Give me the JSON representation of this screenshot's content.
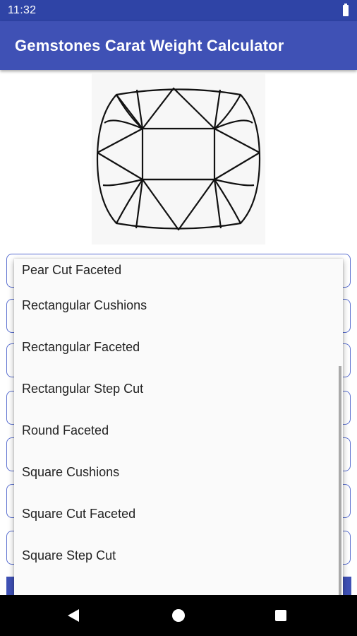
{
  "status_bar": {
    "time": "11:32",
    "battery_icon": "battery-icon"
  },
  "app_bar": {
    "title": "Gemstones Carat Weight Calculator",
    "color": "#3f51b5"
  },
  "gem_image": {
    "icon": "cushion-cut-gem-icon"
  },
  "dropdown": {
    "options": [
      "Pear Cut Faceted",
      "Rectangular Cushions",
      "Rectangular Faceted",
      "Rectangular Step Cut",
      "Round Faceted",
      "Square Cushions",
      "Square Cut Faceted",
      "Square Step Cut"
    ]
  },
  "nav_bar": {
    "back_icon": "back-icon",
    "home_icon": "home-icon",
    "recents_icon": "recents-icon"
  }
}
